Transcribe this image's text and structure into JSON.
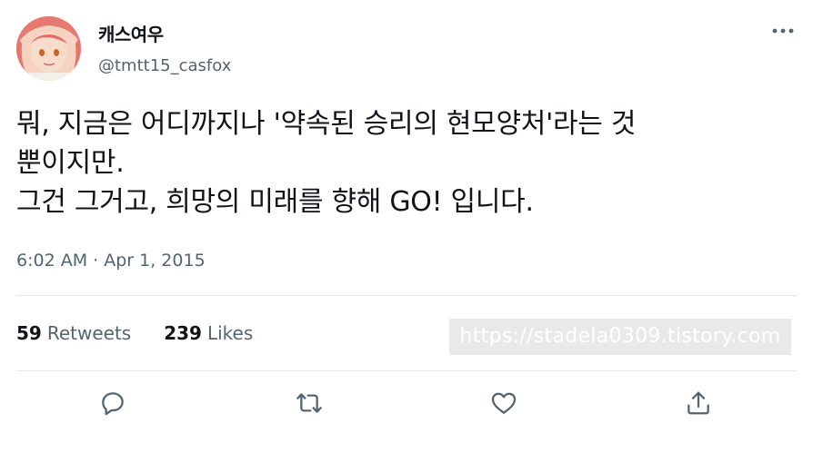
{
  "author": {
    "display_name": "캐스여우",
    "handle": "@tmtt15_casfox"
  },
  "tweet": {
    "lines": [
      "뭐, 지금은 어디까지나 '약속된 승리의 현모양처'라는 것",
      "뿐이지만.",
      "그건 그거고, 희망의 미래를 향해 GO! 입니다."
    ],
    "time": "6:02 AM",
    "separator": " · ",
    "date": "Apr 1, 2015"
  },
  "stats": {
    "retweets_count": "59",
    "retweets_label": "Retweets",
    "likes_count": "239",
    "likes_label": "Likes"
  },
  "watermark": "https://stadela0309.tistory.com",
  "icons": {
    "more": "more-horizontal-icon",
    "reply": "reply-icon",
    "retweet": "retweet-icon",
    "like": "heart-icon",
    "share": "share-icon"
  },
  "colors": {
    "text": "#0f1419",
    "secondary": "#536471",
    "divider": "#e2e7eb",
    "watermark_bg": "#e9e9e9"
  }
}
